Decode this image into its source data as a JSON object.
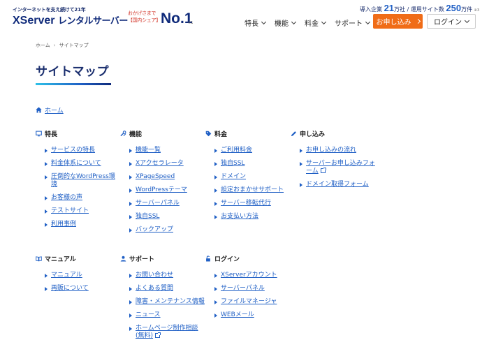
{
  "header": {
    "tagline": "インターネットを支え続けて21年",
    "logo_brand": "XServer",
    "logo_product": "レンタルサーバー",
    "badge_line1": "おかげさまで",
    "badge_line2": "【国内シェア】",
    "badge_no1": "No.1",
    "badge_note": "※1",
    "stats_prefix": "導入企業",
    "stats_companies": "21",
    "stats_companies_unit": "万社 / 運用サイト数",
    "stats_sites": "250",
    "stats_sites_unit": "万件",
    "stats_note": "※3",
    "nav": [
      "特長",
      "機能",
      "料金",
      "サポート"
    ],
    "apply_label": "お申し込み",
    "login_label": "ログイン"
  },
  "breadcrumb": {
    "home": "ホーム",
    "sep": "›",
    "current": "サイトマップ"
  },
  "page_title": "サイトマップ",
  "home_link": "ホーム",
  "sections": [
    {
      "title": "特長",
      "icon": "monitor-icon",
      "items": [
        "サービスの特長",
        "料金体系について",
        "圧倒的なWordPress環境",
        "お客様の声",
        "テストサイト",
        "利用事例"
      ]
    },
    {
      "title": "機能",
      "icon": "tools-icon",
      "items": [
        "機能一覧",
        "Xアクセラレータ",
        "XPageSpeed",
        "WordPressテーマ",
        "サーバーパネル",
        "独自SSL",
        "バックアップ"
      ]
    },
    {
      "title": "料金",
      "icon": "tag-icon",
      "items": [
        "ご利用料金",
        "独自SSL",
        "ドメイン",
        "設定おまかせサポート",
        "サーバー移転代行",
        "お支払い方法"
      ]
    },
    {
      "title": "申し込み",
      "icon": "pen-icon",
      "items": [
        "お申し込みの流れ",
        "サーバーお申し込みフォーム",
        "ドメイン取得フォーム"
      ]
    },
    {
      "title": "マニュアル",
      "icon": "book-icon",
      "items": [
        "マニュアル",
        "再販について"
      ]
    },
    {
      "title": "サポート",
      "icon": "person-icon",
      "items": [
        "お問い合わせ",
        "よくある質問",
        "障害・メンテナンス情報",
        "ニュース",
        "ホームページ制作相談(無料)"
      ]
    },
    {
      "title": "ログイン",
      "icon": "unlock-icon",
      "items": [
        "XServerアカウント",
        "サーバーパネル",
        "ファイルマネージャ",
        "WEBメール"
      ]
    }
  ],
  "colors": {
    "brand_navy": "#0f2a7a",
    "link_blue": "#1f5fc5",
    "apply_orange": "#f06c17"
  }
}
